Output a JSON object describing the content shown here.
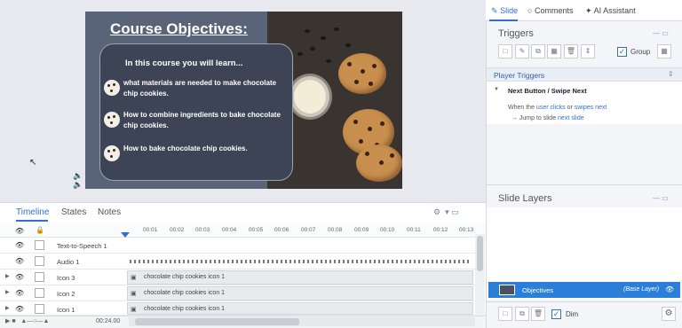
{
  "slide": {
    "title": "Course Objectives:",
    "box_heading": "In this course you will learn...",
    "objectives": [
      "what materials are needed to make chocolate chip cookies.",
      "How to combine ingredients to bake chocolate chip cookies.",
      "How to bake chocolate chip cookies."
    ]
  },
  "timeline": {
    "tabs": [
      "Timeline",
      "States",
      "Notes"
    ],
    "ticks": [
      "00:01",
      "00:02",
      "00:03",
      "00:04",
      "00:05",
      "00:06",
      "00:07",
      "00:08",
      "00:09",
      "00:10",
      "00:11",
      "00:12",
      "00:13"
    ],
    "rows": [
      {
        "label": "Text-to-Speech 1",
        "bar": ""
      },
      {
        "label": "Audio 1",
        "bar": ""
      },
      {
        "label": "Icon 3",
        "bar": "chocolate chip cookies icon 1"
      },
      {
        "label": "Icon 2",
        "bar": "chocolate chip cookies icon 1"
      },
      {
        "label": "Icon 1",
        "bar": "chocolate chip cookies icon 1"
      }
    ],
    "duration": "00:24.00"
  },
  "right_panel": {
    "tabs": [
      "Slide",
      "Comments",
      "AI Assistant"
    ],
    "triggers_title": "Triggers",
    "group_label": "Group",
    "player_triggers": "Player Triggers",
    "trigger_name": "Next Button / Swipe Next",
    "trigger_when_pre": "When the ",
    "trigger_when_user": "user clicks",
    "trigger_when_mid": " or ",
    "trigger_when_swipes": "swipes",
    "trigger_when_next": " next",
    "trigger_action_pre": "Jump to slide ",
    "trigger_action_target": "next slide",
    "slide_layers_title": "Slide Layers",
    "base_layer_name": "Objectives",
    "base_layer_tag": "(Base Layer)",
    "dim_label": "Dim"
  },
  "colors": {
    "accent": "#2f6fd6",
    "selected_layer": "#2c7fd9",
    "slide_bg": "#5a6478"
  }
}
